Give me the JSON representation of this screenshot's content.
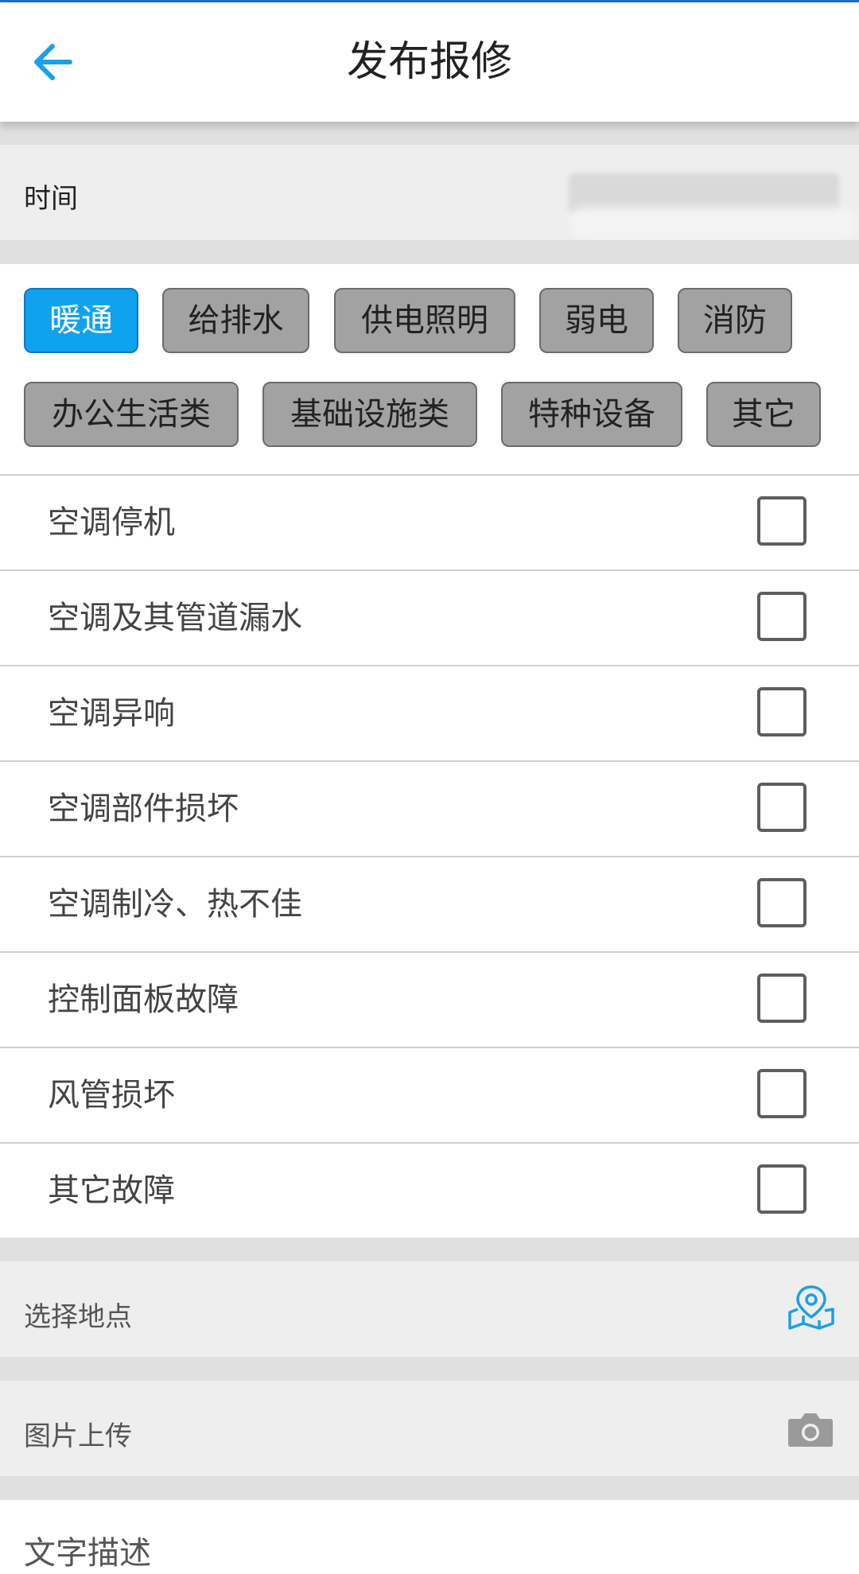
{
  "header": {
    "title": "发布报修",
    "back_icon": "arrow-left-icon",
    "accent_color": "#1aa0ea"
  },
  "time_field": {
    "label": "时间"
  },
  "categories": [
    {
      "label": "暖通",
      "active": true
    },
    {
      "label": "给排水",
      "active": false
    },
    {
      "label": "供电照明",
      "active": false
    },
    {
      "label": "弱电",
      "active": false
    },
    {
      "label": "消防",
      "active": false
    },
    {
      "label": "办公生活类",
      "active": false
    },
    {
      "label": "基础设施类",
      "active": false
    },
    {
      "label": "特种设备",
      "active": false
    },
    {
      "label": "其它",
      "active": false
    }
  ],
  "issues": [
    {
      "label": "空调停机",
      "checked": false
    },
    {
      "label": "空调及其管道漏水",
      "checked": false
    },
    {
      "label": "空调异响",
      "checked": false
    },
    {
      "label": "空调部件损坏",
      "checked": false
    },
    {
      "label": "空调制冷、热不佳",
      "checked": false
    },
    {
      "label": "控制面板故障",
      "checked": false
    },
    {
      "label": "风管损坏",
      "checked": false
    },
    {
      "label": "其它故障",
      "checked": false
    }
  ],
  "location_field": {
    "label": "选择地点",
    "icon": "map-pin-icon"
  },
  "photo_field": {
    "label": "图片上传",
    "icon": "camera-icon"
  },
  "description_field": {
    "label": "文字描述"
  }
}
